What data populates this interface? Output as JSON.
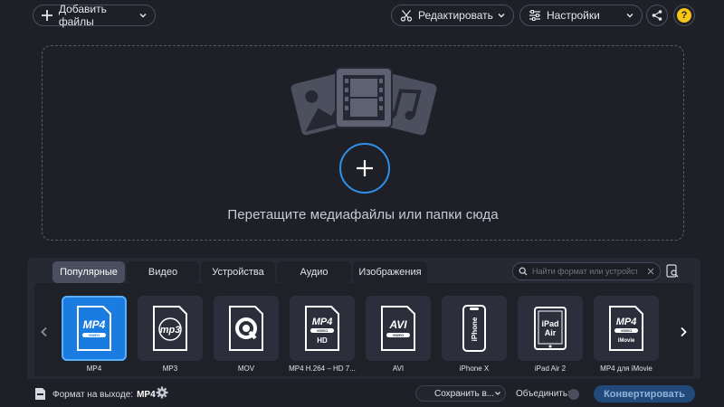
{
  "toolbar": {
    "add_files": "Добавить файлы",
    "edit": "Редактировать",
    "settings": "Настройки",
    "help": "?"
  },
  "dropzone": {
    "text": "Перетащите медиафайлы или папки сюда"
  },
  "tabs": [
    {
      "label": "Популярные",
      "active": true
    },
    {
      "label": "Видео",
      "active": false
    },
    {
      "label": "Устройства",
      "active": false
    },
    {
      "label": "Аудио",
      "active": false
    },
    {
      "label": "Изображения",
      "active": false
    }
  ],
  "search": {
    "placeholder": "Найти формат или устройство..."
  },
  "formats": [
    {
      "label": "MP4",
      "icon": "mp4-icon",
      "badge": "MP4",
      "sub": "VIDEO",
      "selected": true
    },
    {
      "label": "MP3",
      "icon": "mp3-icon",
      "badge": "mp3",
      "selected": false
    },
    {
      "label": "MOV",
      "icon": "mov-icon",
      "badge": "Q",
      "selected": false
    },
    {
      "label": "MP4 H.264 – HD 7...",
      "icon": "mp4-hd-icon",
      "badge": "MP4",
      "sub": "VIDEO",
      "extra": "HD",
      "selected": false
    },
    {
      "label": "AVI",
      "icon": "avi-icon",
      "badge": "AVI",
      "sub": "VIDEO",
      "selected": false
    },
    {
      "label": "iPhone X",
      "icon": "iphone-icon",
      "badge": "iPhone",
      "selected": false
    },
    {
      "label": "iPad Air 2",
      "icon": "ipad-icon",
      "badge": "iPad",
      "extra": "Air",
      "selected": false
    },
    {
      "label": "MP4 для iMovie",
      "icon": "mp4-imovie-icon",
      "badge": "MP4",
      "sub": "VIDEO",
      "extra": "iMovie",
      "selected": false
    }
  ],
  "statusbar": {
    "output_label": "Формат на выходе:",
    "output_value": "MP4",
    "save_to": "Сохранить в...",
    "merge_label": "Объединить:",
    "convert": "Конвертировать"
  },
  "colors": {
    "accent": "#2f8fe6",
    "background": "#1f2027",
    "panel": "#262934",
    "selected_tile": "#1a7be0"
  }
}
